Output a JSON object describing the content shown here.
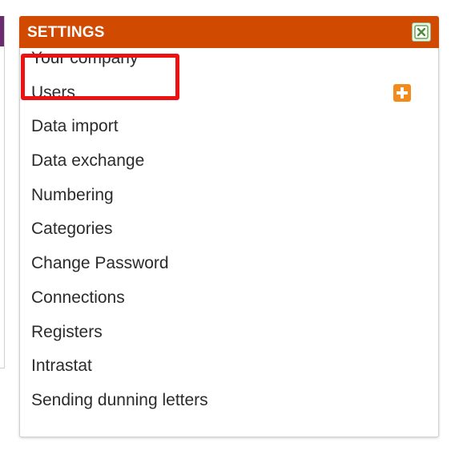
{
  "panel": {
    "title": "SETTINGS",
    "close_icon": "close-icon",
    "colors": {
      "header": "#d04a02",
      "side_panel_header": "#6a2c6e",
      "highlight": "#ee1111",
      "add_button": "#f28a1c"
    }
  },
  "menu": {
    "items": [
      "Your company",
      "Users",
      "Data import",
      "Data exchange",
      "Numbering",
      "Categories",
      "Change Password",
      "Connections",
      "Registers",
      "Intrastat",
      "Sending dunning letters"
    ],
    "add_user_icon": "plus-icon",
    "highlighted_item": "Your company"
  }
}
